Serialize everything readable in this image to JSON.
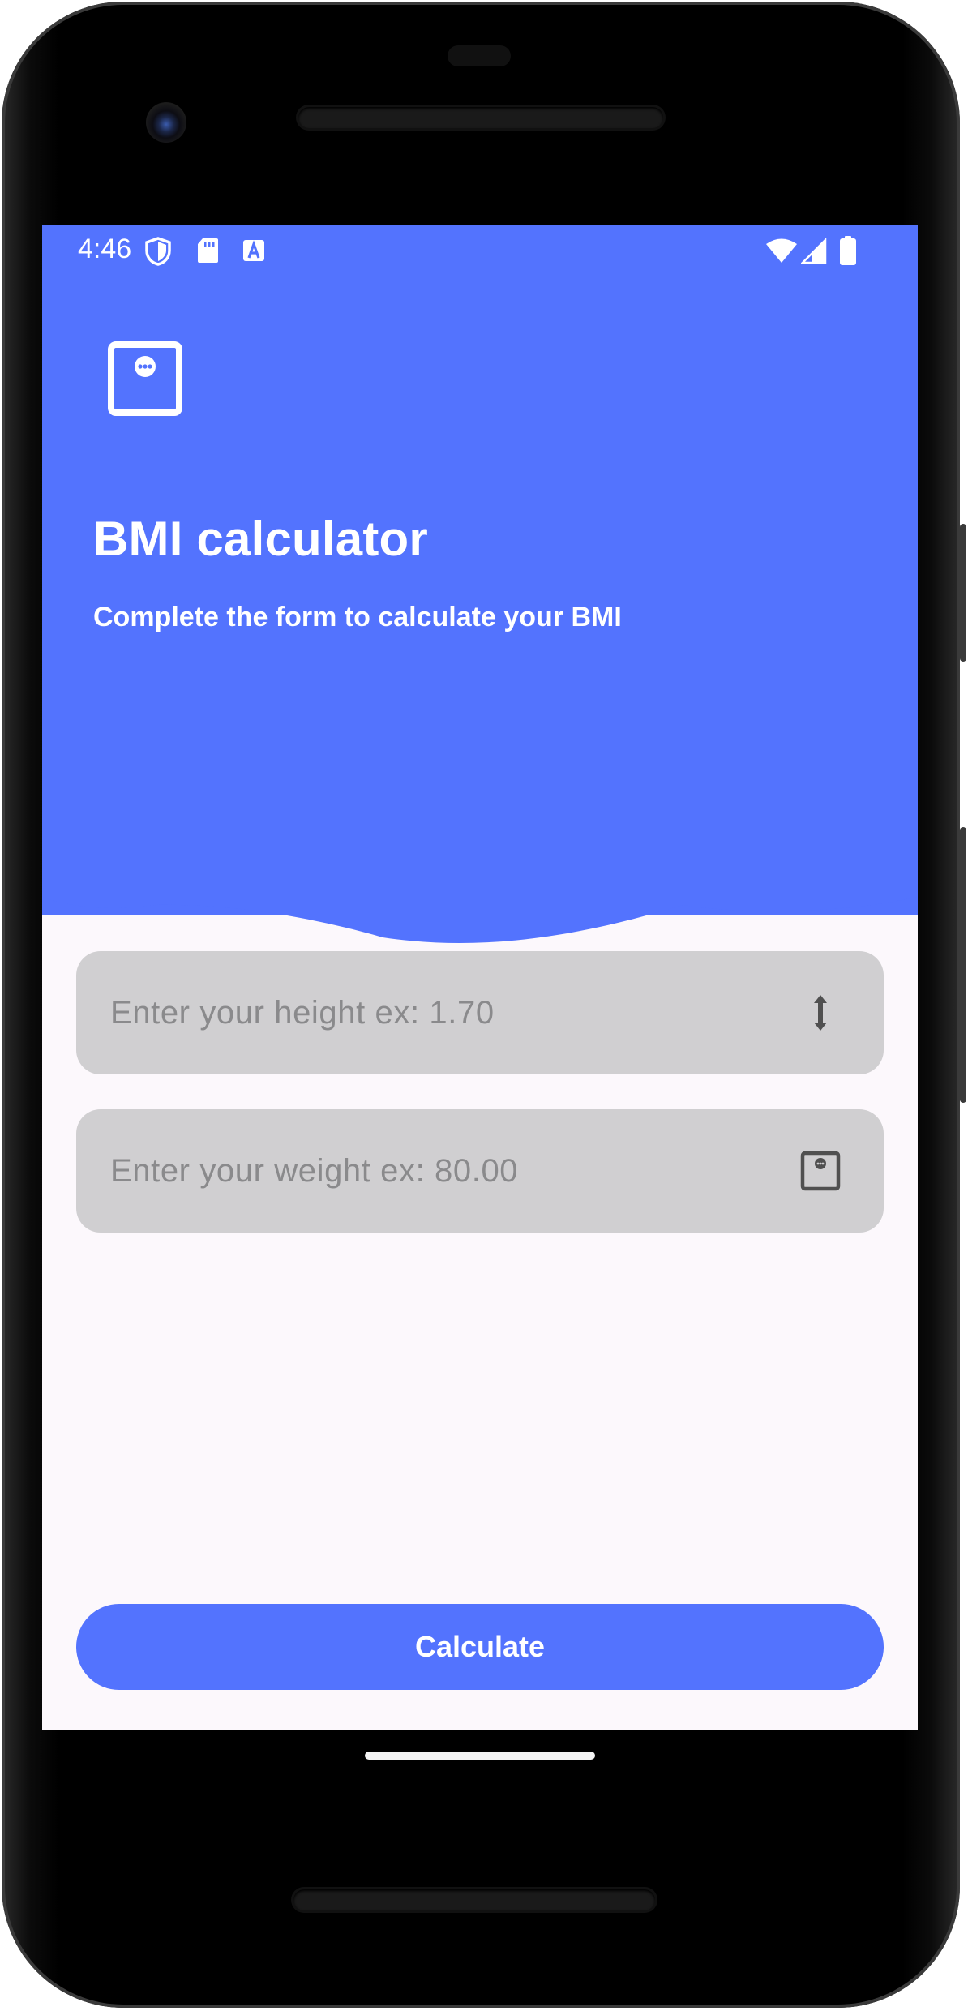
{
  "status_bar": {
    "time": "4:46",
    "left_icons": [
      "shield-icon",
      "sd-card-icon",
      "text-a-icon"
    ],
    "right_icons": [
      "wifi-icon",
      "signal-icon",
      "battery-icon"
    ]
  },
  "header": {
    "title": "BMI calculator",
    "subtitle": "Complete the form to calculate your BMI",
    "logo_icon": "scale-icon",
    "color": "#5373fe"
  },
  "form": {
    "height_field": {
      "placeholder": "Enter your height ex: 1.70",
      "value": "",
      "icon": "height-arrows-icon"
    },
    "weight_field": {
      "placeholder": "Enter your weight ex: 80.00",
      "value": "",
      "icon": "scale-icon"
    }
  },
  "actions": {
    "calculate_label": "Calculate"
  },
  "colors": {
    "accent": "#5373fe",
    "field_background": "#d0cfd1",
    "screen_background": "#fcf8fc"
  }
}
